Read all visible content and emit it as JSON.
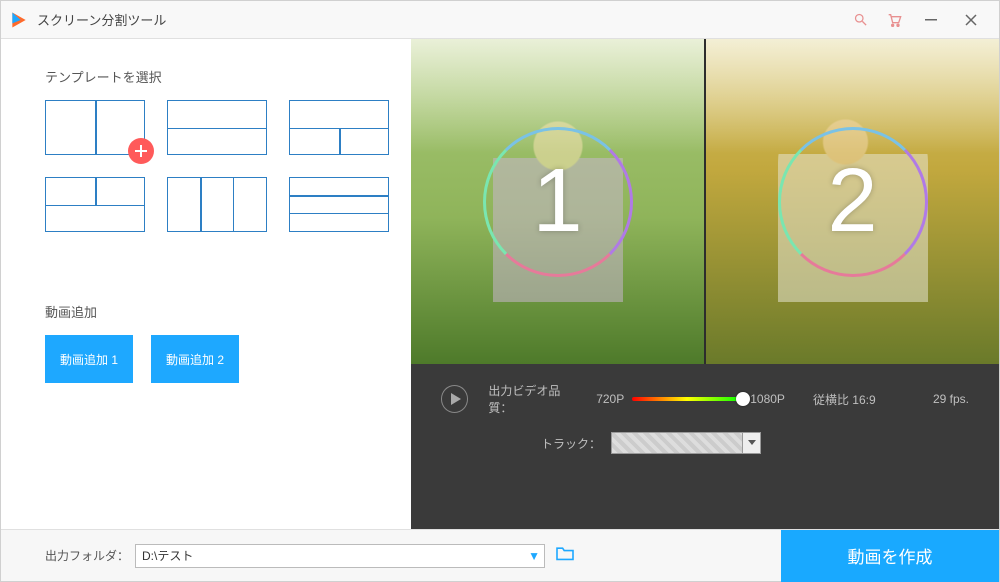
{
  "titlebar": {
    "title": "スクリーン分割ツール"
  },
  "left": {
    "template_section_label": "テンプレートを選択",
    "add_section_label": "動画追加",
    "add_buttons": [
      "動画追加 1",
      "動画追加 2"
    ]
  },
  "preview": {
    "pane1_number": "1",
    "pane2_number": "2"
  },
  "controls": {
    "quality_label": "出力ビデオ品質：",
    "quality_low": "720P",
    "quality_high": "1080P",
    "aspect_label": "従横比",
    "aspect_value": "16:9",
    "fps_value": "29",
    "fps_unit": "fps.",
    "track_label": "トラック："
  },
  "footer": {
    "folder_label": "出力フォルダ：",
    "folder_path": "D:\\テスト",
    "create_label": "動画を作成"
  }
}
